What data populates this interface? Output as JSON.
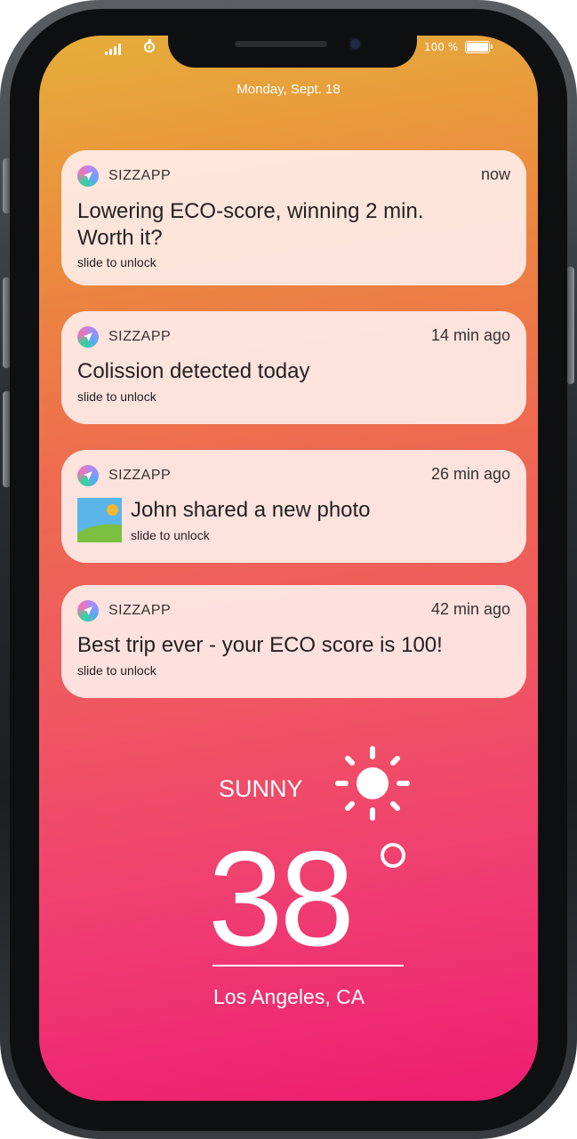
{
  "status": {
    "battery_text": "100 %"
  },
  "date": "Monday, Sept. 18",
  "notifications": [
    {
      "app": "SIZZAPP",
      "time": "now",
      "message_line1": "Lowering ECO-score, winning 2 min.",
      "message_line2": "Worth it?",
      "hint": "slide to unlock"
    },
    {
      "app": "SIZZAPP",
      "time": "14 min ago",
      "message": "Colission detected today",
      "hint": "slide to unlock"
    },
    {
      "app": "SIZZAPP",
      "time": "26 min ago",
      "message": "John shared a new photo",
      "hint": "slide to unlock"
    },
    {
      "app": "SIZZAPP",
      "time": "42 min ago",
      "message": "Best trip ever - your ECO score is 100!",
      "hint": "slide to unlock"
    }
  ],
  "weather": {
    "condition": "SUNNY",
    "temperature": "38",
    "location": "Los Angeles, CA"
  },
  "colors": {
    "gradient_top": "#e5ae3a",
    "gradient_bottom": "#ee1e70",
    "card_bg": "#ffece8"
  }
}
